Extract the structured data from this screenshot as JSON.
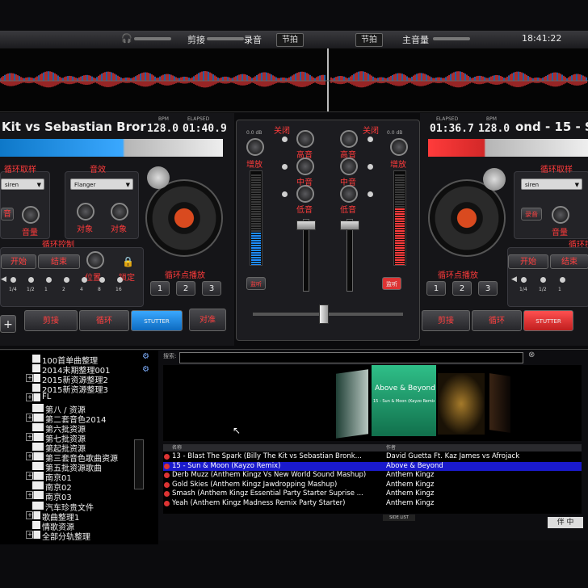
{
  "topbar": {
    "crossfade_label": "剪接",
    "record_label": "录音",
    "beat_left": "节拍",
    "beat_right": "节拍",
    "master_volume_label": "主音量",
    "clock": "18:41:22"
  },
  "left_deck": {
    "title": "Kit vs Sebastian Bror",
    "bpm_label": "BPM",
    "bpm": "128.0",
    "elapsed_label": "ELAPSED",
    "elapsed": "01:40.9",
    "sampler_label": "循环取样",
    "sampler_select": "siren",
    "sampler_btn": "音",
    "volume_label": "音量",
    "effect_label": "音效",
    "effect_select": "Flanger",
    "param1_label": "对象",
    "param2_label": "对象",
    "loop_control_label": "循环控制",
    "loop_start": "开始",
    "loop_end": "结束",
    "position_label": "位置",
    "lock_label": "锁定",
    "loop_sizes": [
      "1/4",
      "1/2",
      "1",
      "2",
      "4",
      "8",
      "16"
    ],
    "cue_label": "循环点播放",
    "cue_buttons": [
      "1",
      "2",
      "3"
    ],
    "plus": "+",
    "play_buttons": [
      "剪接",
      "循环",
      "STUTTER"
    ],
    "sync_button": "对准"
  },
  "right_deck": {
    "title": "ond - 15 - S",
    "bpm_label": "BPM",
    "bpm": "128.0",
    "elapsed_label": "ELAPSED",
    "elapsed": "01:36.7",
    "sampler_label": "循环取样",
    "sampler_select": "siren",
    "sampler_btn": "录音",
    "volume_label": "音量",
    "loop_control_label": "循环控制",
    "loop_start": "开始",
    "loop_end": "结束",
    "loop_sizes": [
      "1/4",
      "1/2",
      "1"
    ],
    "cue_label": "循环点播放",
    "cue_buttons": [
      "1",
      "2",
      "3"
    ],
    "play_buttons": [
      "剪接",
      "循环",
      "STUTTER"
    ]
  },
  "mixer": {
    "kill_left": "关闭",
    "kill_right": "关闭",
    "gain_left": "增放",
    "gain_right": "增放",
    "db_left": "0.0 dB",
    "db_right": "0.0 dB",
    "high": "高音",
    "mid": "中音",
    "low": "低音",
    "btn_left": "监听",
    "btn_right": "监听"
  },
  "browser": {
    "search_label": "搜索:",
    "folders": [
      "100首单曲整理",
      "2014末期整理001",
      "2015新资源整理2",
      "2015新资源整理3",
      "FL",
      "第八 / 资源",
      "第二套音色2014",
      "第六批资源",
      "第七批资源",
      "第起批资源",
      "第三套音色歌曲资源",
      "第五批资源歌曲",
      "南京01",
      "南京02",
      "南京03",
      "汽车珍贵文件",
      "歌曲整理1",
      "情歌资源",
      "全部分轨整理"
    ],
    "col_title": "名称",
    "col_artist": "作者",
    "album_cover_line1": "Above & Beyond",
    "album_cover_line2": "15 - Sun & Moon (Kayzo Remix)",
    "tracks": [
      {
        "title": "13 - Blast The Spark (Billy The Kit vs Sebastian Bronk...",
        "artist": "David Guetta Ft. Kaz James vs Afrojack"
      },
      {
        "title": "15 - Sun & Moon (Kayzo Remix)",
        "artist": "Above & Beyond"
      },
      {
        "title": "Derb Muzz (Anthem Kingz Vs New World Sound Mashup)",
        "artist": "Anthem Kingz"
      },
      {
        "title": "Gold Skies (Anthem Kingz Jawdropping Mashup)",
        "artist": "Anthem Kingz"
      },
      {
        "title": "Smash (Anthem Kingz Essential Party Starter Suprise ...",
        "artist": "Anthem Kingz"
      },
      {
        "title": "Yeah (Anthem Kingz Madness Remix Party Starter)",
        "artist": "Anthem Kingz"
      }
    ],
    "selected_track_index": 1,
    "side_list_label": "SIDE LIST",
    "corner_label": "伴 中"
  },
  "colors": {
    "accent_blue": "#1e8cff",
    "accent_red": "#ff3b3b",
    "selection": "#1a1acc"
  }
}
